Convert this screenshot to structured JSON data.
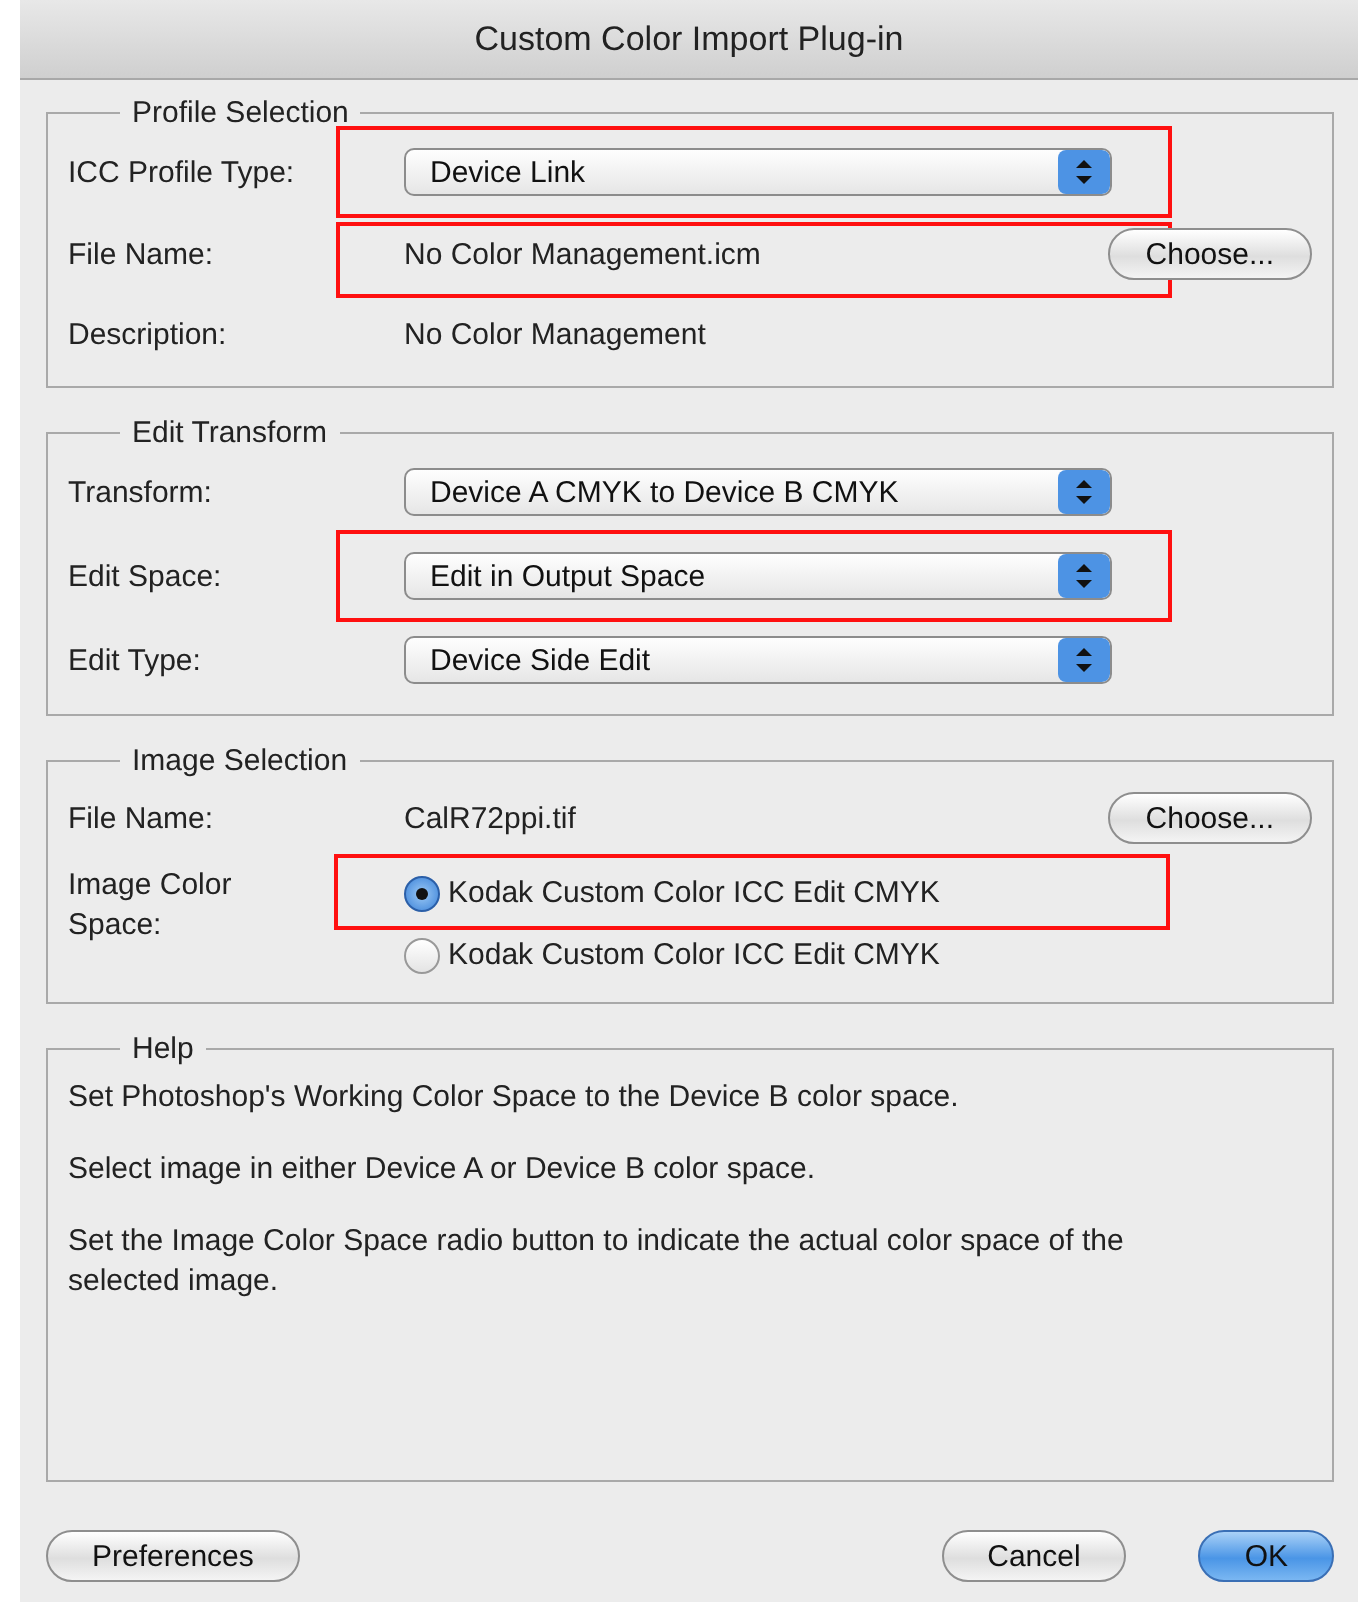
{
  "window": {
    "title": "Custom Color Import Plug-in"
  },
  "groups": [
    {
      "title": "Profile Selection",
      "rows": [
        {
          "kind": "popup",
          "label": "ICC Profile Type:",
          "value": "Device Link",
          "highlighted": true
        },
        {
          "kind": "file",
          "label": "File Name:",
          "value": "No Color Management.icm",
          "button": "Choose...",
          "highlighted": true
        },
        {
          "kind": "text",
          "label": "Description:",
          "value": "No Color Management",
          "highlighted": false
        }
      ]
    },
    {
      "title": "Edit Transform",
      "rows": [
        {
          "kind": "popup",
          "label": "Transform:",
          "value": "Device A CMYK to Device B CMYK",
          "highlighted": false
        },
        {
          "kind": "popup",
          "label": "Edit Space:",
          "value": "Edit in Output Space",
          "highlighted": true
        },
        {
          "kind": "popup",
          "label": "Edit Type:",
          "value": "Device Side Edit",
          "highlighted": false
        }
      ]
    },
    {
      "title": "Image Selection",
      "rows": [
        {
          "kind": "file",
          "label": "File Name:",
          "value": "CalR72ppi.tif",
          "button": "Choose...",
          "highlighted": false
        },
        {
          "kind": "radio",
          "label": "Image Color Space:",
          "options": [
            {
              "label": "Kodak Custom Color ICC Edit CMYK",
              "selected": true,
              "highlighted": true
            },
            {
              "label": "Kodak Custom Color ICC Edit CMYK",
              "selected": false,
              "highlighted": false
            }
          ]
        }
      ]
    }
  ],
  "help": {
    "title": "Help",
    "paragraphs": [
      "Set Photoshop's Working Color Space to the Device B color space.",
      "Select image in either Device A or Device B color space.",
      "Set the Image Color Space radio button to indicate the actual color space of the selected image."
    ]
  },
  "buttons": [
    {
      "label": "Preferences",
      "kind": "plain"
    },
    {
      "label": "Cancel",
      "kind": "plain"
    },
    {
      "label": "OK",
      "kind": "default"
    }
  ]
}
